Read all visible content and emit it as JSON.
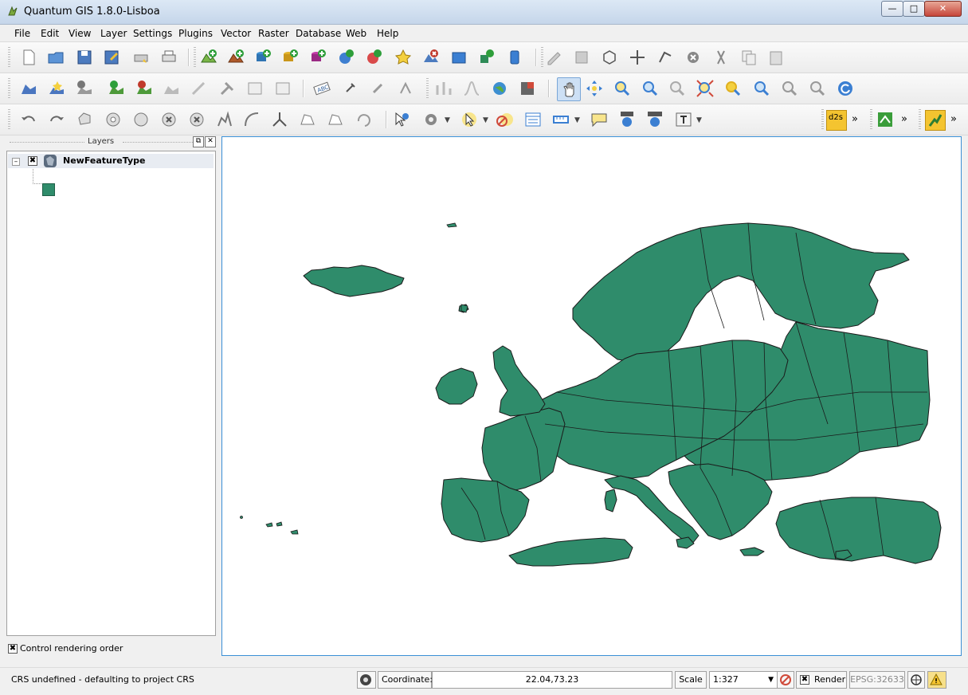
{
  "window": {
    "title": "Quantum GIS 1.8.0-Lisboa"
  },
  "menu": [
    "File",
    "Edit",
    "View",
    "Layer",
    "Settings",
    "Plugins",
    "Vector",
    "Raster",
    "Database",
    "Web",
    "Help"
  ],
  "layers_panel": {
    "title": "Layers",
    "layer_name": "NewFeatureType",
    "layer_visible": true,
    "control_rendering_label": "Control rendering order",
    "symbol_color": "#2f8c6b"
  },
  "map": {
    "fill_color": "#2f8c6b",
    "stroke_color": "#1a1a1a",
    "background": "#ffffff"
  },
  "status": {
    "message": "CRS undefined - defaulting to project CRS",
    "coordinate_label": "Coordinate:",
    "coordinate_value": "22.04,73.23",
    "scale_label": "Scale",
    "scale_value": "1:327",
    "render_label": "Render",
    "crs": "EPSG:32633"
  },
  "plugin_label": "d2s"
}
